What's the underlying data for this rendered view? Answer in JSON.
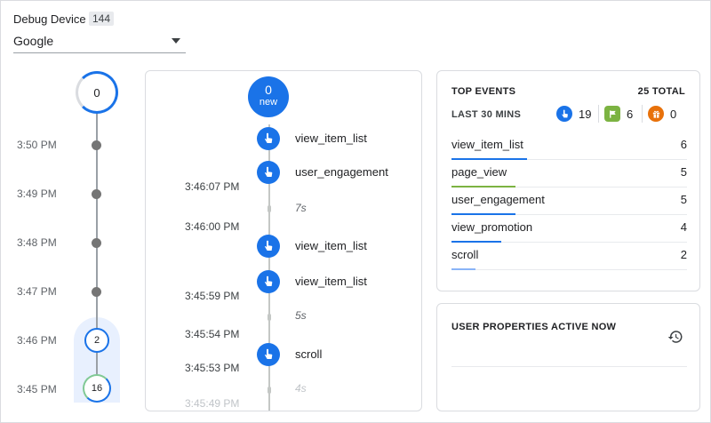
{
  "header": {
    "device_label": "Debug Device",
    "device_count": "144",
    "device_value": "Google"
  },
  "minutes": {
    "top_count": "0",
    "rows": [
      {
        "time": "3:50 PM"
      },
      {
        "time": "3:49 PM"
      },
      {
        "time": "3:48 PM"
      },
      {
        "time": "3:47 PM"
      },
      {
        "time": "3:46 PM",
        "count": "2"
      },
      {
        "time": "3:45 PM",
        "count": "16"
      }
    ]
  },
  "seconds": {
    "new_count": "0",
    "new_label": "new",
    "events": [
      {
        "name": "view_item_list"
      },
      {
        "name": "user_engagement"
      },
      {
        "name": "view_item_list"
      },
      {
        "name": "view_item_list"
      },
      {
        "name": "scroll"
      }
    ],
    "timestamps": [
      "3:46:07 PM",
      "3:46:00 PM",
      "3:45:59 PM",
      "3:45:54 PM",
      "3:45:53 PM",
      "3:45:49 PM"
    ],
    "gaps": [
      "7s",
      "5s",
      "4s"
    ]
  },
  "top_events": {
    "title": "TOP EVENTS",
    "total": "25 TOTAL",
    "period": "LAST 30 MINS",
    "counts": [
      {
        "icon": "pointer-icon",
        "value": "19",
        "color": "#1a73e8"
      },
      {
        "icon": "flag-icon",
        "value": "6",
        "color": "#7cb342"
      },
      {
        "icon": "gift-icon",
        "value": "0",
        "color": "#e8710a"
      }
    ],
    "rows": [
      {
        "name": "view_item_list",
        "count": "6",
        "share": 0.32,
        "color": "#1a73e8"
      },
      {
        "name": "page_view",
        "count": "5",
        "share": 0.27,
        "color": "#7cb342"
      },
      {
        "name": "user_engagement",
        "count": "5",
        "share": 0.27,
        "color": "#1a73e8"
      },
      {
        "name": "view_promotion",
        "count": "4",
        "share": 0.21,
        "color": "#1a73e8"
      },
      {
        "name": "scroll",
        "count": "2",
        "share": 0.1,
        "color": "#8ab4f8"
      }
    ]
  },
  "user_properties": {
    "title": "USER PROPERTIES ACTIVE NOW",
    "icon": "history-icon"
  }
}
